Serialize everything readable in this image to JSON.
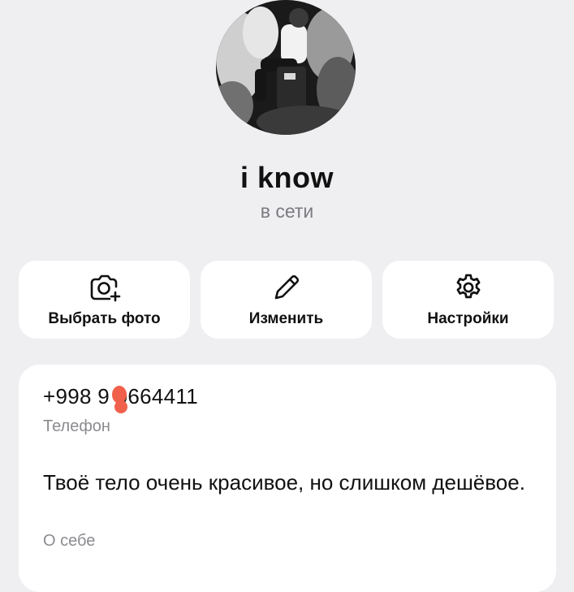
{
  "profile": {
    "name": "i know",
    "status": "в сети"
  },
  "actions": [
    {
      "label": "Выбрать фото",
      "icon": "camera-plus-icon"
    },
    {
      "label": "Изменить",
      "icon": "pencil-icon"
    },
    {
      "label": "Настройки",
      "icon": "gear-icon"
    }
  ],
  "info": {
    "phone_value": "+998 9 0664411",
    "phone_label": "Телефон",
    "about_value": "Твоё тело очень красивое, но слишком дешёвое.",
    "about_label": "О себе"
  },
  "colors": {
    "background": "#efeff2",
    "card": "#ffffff",
    "secondary_text": "#8b8b90",
    "redaction_mark": "#f0604a"
  }
}
